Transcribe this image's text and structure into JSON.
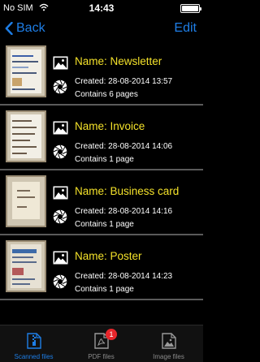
{
  "status_bar": {
    "carrier": "No SIM",
    "time": "14:43",
    "battery_level": 1.0
  },
  "nav": {
    "back_label": "Back",
    "edit_label": "Edit"
  },
  "documents": [
    {
      "name": "Name: Newsletter",
      "created": "Created: 28-08-2014 13:57",
      "pages": "Contains 6 pages"
    },
    {
      "name": "Name: Invoice",
      "created": "Created: 28-08-2014 14:06",
      "pages": "Contains 1 page"
    },
    {
      "name": "Name: Business card",
      "created": "Created: 28-08-2014 14:16",
      "pages": "Contains 1 page"
    },
    {
      "name": "Name: Poster",
      "created": "Created: 28-08-2014 14:23",
      "pages": "Contains 1 page"
    }
  ],
  "tabs": [
    {
      "label": "Scanned files",
      "icon": "zip-file-icon",
      "active": true
    },
    {
      "label": "PDF files",
      "icon": "pdf-file-icon",
      "badge": "1"
    },
    {
      "label": "Image files",
      "icon": "image-file-icon"
    }
  ],
  "colors": {
    "accent": "#1e7ee6",
    "name_text": "#f4e22a",
    "badge": "#e8262b"
  }
}
